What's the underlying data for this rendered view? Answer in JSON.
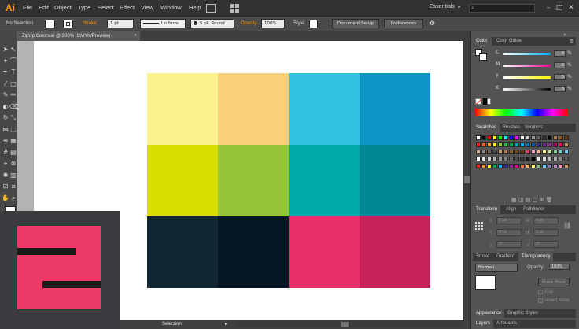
{
  "app": {
    "logo": "Ai"
  },
  "menu": [
    "File",
    "Edit",
    "Object",
    "Type",
    "Select",
    "Effect",
    "View",
    "Window",
    "Help"
  ],
  "workspace": {
    "label": "Essentials"
  },
  "controlbar": {
    "selection": "No Selection",
    "stroke_label": "Stroke:",
    "stroke_weight": "1 pt",
    "profile": "Uniform",
    "brush": "5 pt. Round",
    "opacity_label": "Opacity:",
    "opacity_value": "100%",
    "style_label": "Style:",
    "doc_setup": "Document Setup",
    "preferences": "Preferences"
  },
  "document": {
    "tab_title": "ZipUp Colors.ai @ 200% (CMYK/Preview)",
    "close": "×"
  },
  "colors": {
    "grid": [
      [
        "#fcf28d",
        "#f8d07c",
        "#33c2e2",
        "#0a95c4"
      ],
      [
        "#d8dd02",
        "#94c536",
        "#00aba7",
        "#008796"
      ],
      [
        "#122736",
        "#041623",
        "#e9306b",
        "#c62259"
      ]
    ],
    "accent_orange": "#ff9a00",
    "logo_pink": "#ee3a66"
  },
  "panels": {
    "color": {
      "tabs": [
        "Color",
        "Color Guide"
      ],
      "sliders": [
        {
          "label": "C",
          "value": "0",
          "gradient": "linear-gradient(90deg,#ffffff,#00aeef)"
        },
        {
          "label": "M",
          "value": "0",
          "gradient": "linear-gradient(90deg,#ffffff,#ec008c)"
        },
        {
          "label": "Y",
          "value": "0",
          "gradient": "linear-gradient(90deg,#ffffff,#fff200)"
        },
        {
          "label": "K",
          "value": "0",
          "gradient": "linear-gradient(90deg,#ffffff,#000000)"
        }
      ],
      "pct": "%"
    },
    "swatches": {
      "tabs": [
        "Swatches",
        "Brushes",
        "Symbols"
      ]
    },
    "transform": {
      "tabs": [
        "Transform",
        "Align",
        "Pathfinder"
      ],
      "fields": {
        "x_label": "X:",
        "x_value": "0 pt",
        "y_label": "Y:",
        "y_value": "0 pt",
        "w_label": "W:",
        "w_value": "0 pt",
        "h_label": "H:",
        "h_value": "0 pt",
        "angle_label": "△:",
        "angle_value": "0°",
        "shear_label": "⊿:",
        "shear_value": "0°"
      }
    },
    "transparency": {
      "tabs": [
        "Stroke",
        "Gradient",
        "Transparency"
      ],
      "blend_mode": "Normal",
      "opacity_label": "Opacity:",
      "opacity_value": "100%",
      "make_mask": "Make Mask",
      "clip": "Clip",
      "invert_mask": "Invert Mask"
    },
    "appearance": {
      "tabs": [
        "Appearance",
        "Graphic Styles"
      ]
    },
    "layers": {
      "tabs": [
        "Layers",
        "Artboards"
      ]
    }
  },
  "status": {
    "tool": "Selection"
  }
}
